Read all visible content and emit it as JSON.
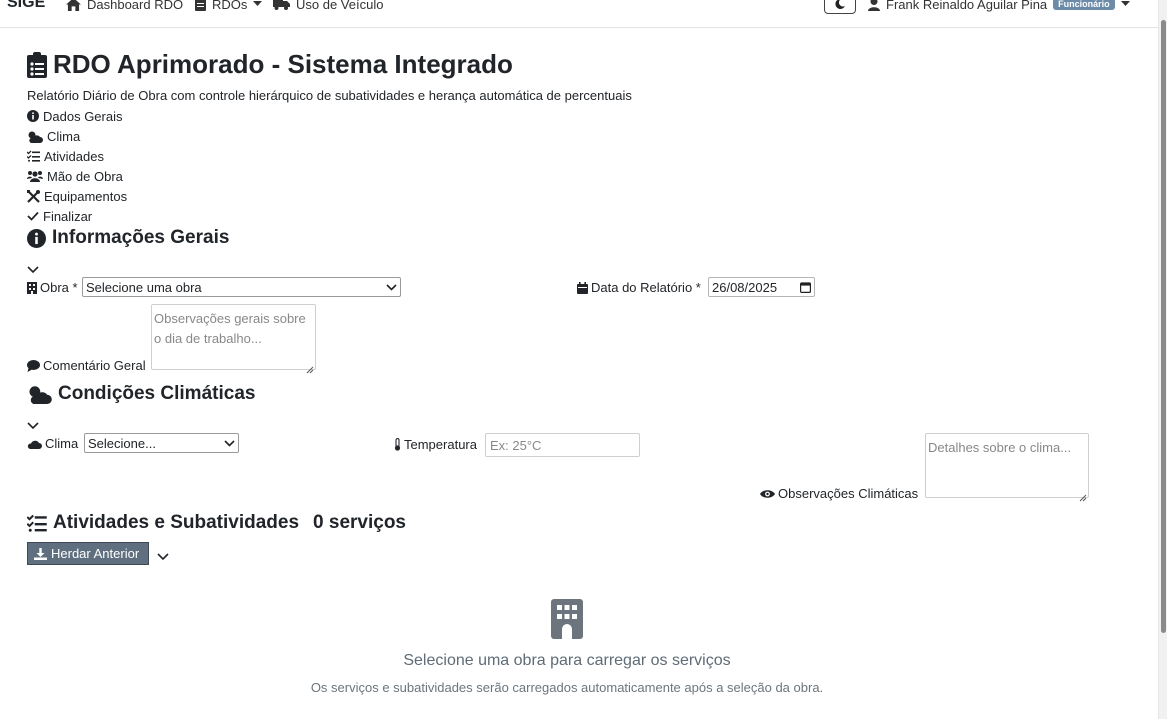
{
  "nav": {
    "brand": "SIGE",
    "dashboard": "Dashboard RDO",
    "rdos": "RDOs",
    "veiculo": "Uso de Veículo",
    "user_name": "Frank Reinaldo Aguilar Pina",
    "role_badge": "Funcionário"
  },
  "header": {
    "title": "RDO Aprimorado - Sistema Integrado",
    "subtitle": "Relatório Diário de Obra com controle hierárquico de subatividades e herança automática de percentuais"
  },
  "steps": [
    {
      "label": "Dados Gerais",
      "icon": "info-circle-icon"
    },
    {
      "label": "Clima",
      "icon": "cloud-sun-icon"
    },
    {
      "label": "Atividades",
      "icon": "tasks-icon"
    },
    {
      "label": "Mão de Obra",
      "icon": "users-icon"
    },
    {
      "label": "Equipamentos",
      "icon": "tools-icon"
    },
    {
      "label": "Finalizar",
      "icon": "check-icon"
    }
  ],
  "gerais": {
    "title": "Informações Gerais",
    "obra_label": "Obra *",
    "obra_value": "Selecione uma obra",
    "data_label": "Data do Relatório *",
    "data_value": "26/08/2025",
    "comentario_label": "Comentário Geral",
    "comentario_placeholder": "Observações gerais sobre o dia de trabalho..."
  },
  "clima": {
    "title": "Condições Climáticas",
    "clima_label": "Clima",
    "clima_value": "Selecione...",
    "temp_label": "Temperatura",
    "temp_placeholder": "Ex: 25°C",
    "obs_label": "Observações Climáticas",
    "obs_placeholder": "Detalhes sobre o clima..."
  },
  "atividades": {
    "title": "Atividades e Subatividades",
    "count": "0 serviços",
    "herdar_label": "Herdar Anterior",
    "empty_title": "Selecione uma obra para carregar os serviços",
    "empty_sub": "Os serviços e subatividades serão carregados automaticamente após a seleção da obra."
  },
  "colors": {
    "button_bg": "#5f6f7f",
    "badge_bg": "#6c8ba8",
    "text": "#212529"
  }
}
